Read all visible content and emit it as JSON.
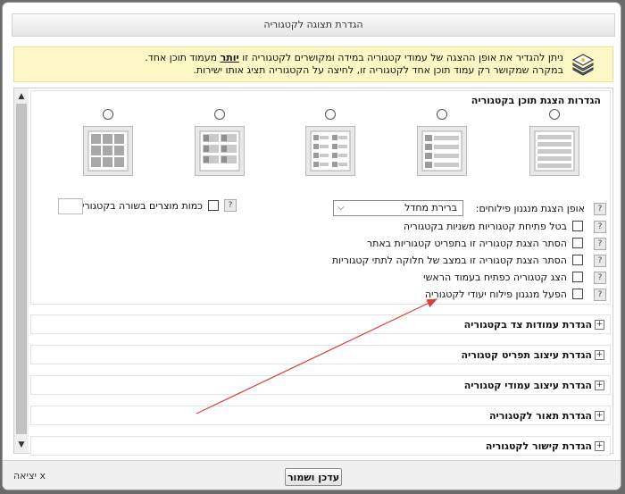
{
  "window_title": "הגדרת תצוגה לקטגוריה",
  "notice": {
    "line1_a": "ניתן להגדיר את אופן ההצגה של עמודי קטגוריה במידה ומקושרים לקטגוריה זו ",
    "line1_u": "יותר",
    "line1_b": " מעמוד תוכן אחד.",
    "line2": "במקרה שמקושר רק עמוד תוכן אחד לקטגוריה זו, לחיצה על הקטגוריה תציג אותו ישירות."
  },
  "main_panel": {
    "title": "הגדרות הצגת תוכן בקטגוריה",
    "filter_label": "אופן הצגת מנגנון פילוחים:",
    "filter_select": "ברירת מחדל",
    "products_per_row_label": "כמות מוצרים בשורה בקטגוריה",
    "options": [
      "בטל פתיחת קטגוריות משניות בקטגוריה",
      "הסתר הצגת קטגוריה זו בתפריט קטגוריות באתר",
      "הסתר הצגת קטגוריה זו במצב של חלוקה לתתי קטגוריות",
      "הצג קטגוריה כפתיח בעמוד הראשי",
      "הפעל מנגנון פילוח יעודי לקטגוריה"
    ],
    "help_glyph": "?"
  },
  "sections": [
    "הגדרת עמודות צד בקטגוריה",
    "הגדרת עיצוב תפריט קטגוריה",
    "הגדרת עיצוב עמודי קטגוריה",
    "הגדרת תאור לקטגוריה",
    "הגדרת קישור לקטגוריה"
  ],
  "footer": {
    "save_label": "עדכן ושמור",
    "exit_label": "x יציאה"
  },
  "icons": {
    "notice": "layers-icon",
    "expand": "plus-box-icon",
    "help": "question-icon"
  },
  "colors": {
    "notice_bg": "#fcf7c5",
    "annotation_arrow": "#d9403a"
  }
}
